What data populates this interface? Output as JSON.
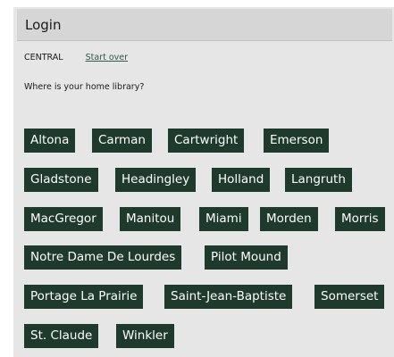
{
  "header": {
    "title": "Login"
  },
  "breadcrumb": {
    "location": "CENTRAL",
    "start_over": "Start over"
  },
  "prompt": {
    "question": "Where is your home library?"
  },
  "libraries": [
    "Altona",
    "Carman",
    "Cartwright",
    "Emerson",
    "Gladstone",
    "Headingley",
    "Holland",
    "Langruth",
    "MacGregor",
    "Manitou",
    "Miami",
    "Morden",
    "Morris",
    "Notre Dame De Lourdes",
    "Pilot Mound",
    "Portage La Prairie",
    "Saint-Jean-Baptiste",
    "Somerset",
    "St. Claude",
    "Winkler"
  ],
  "colors": {
    "button_bg": "#1e3a2c",
    "button_text": "#ffffff",
    "panel_bg": "#e6e6e6",
    "header_bg": "#d6d6d6",
    "link": "#2e5a4a"
  }
}
